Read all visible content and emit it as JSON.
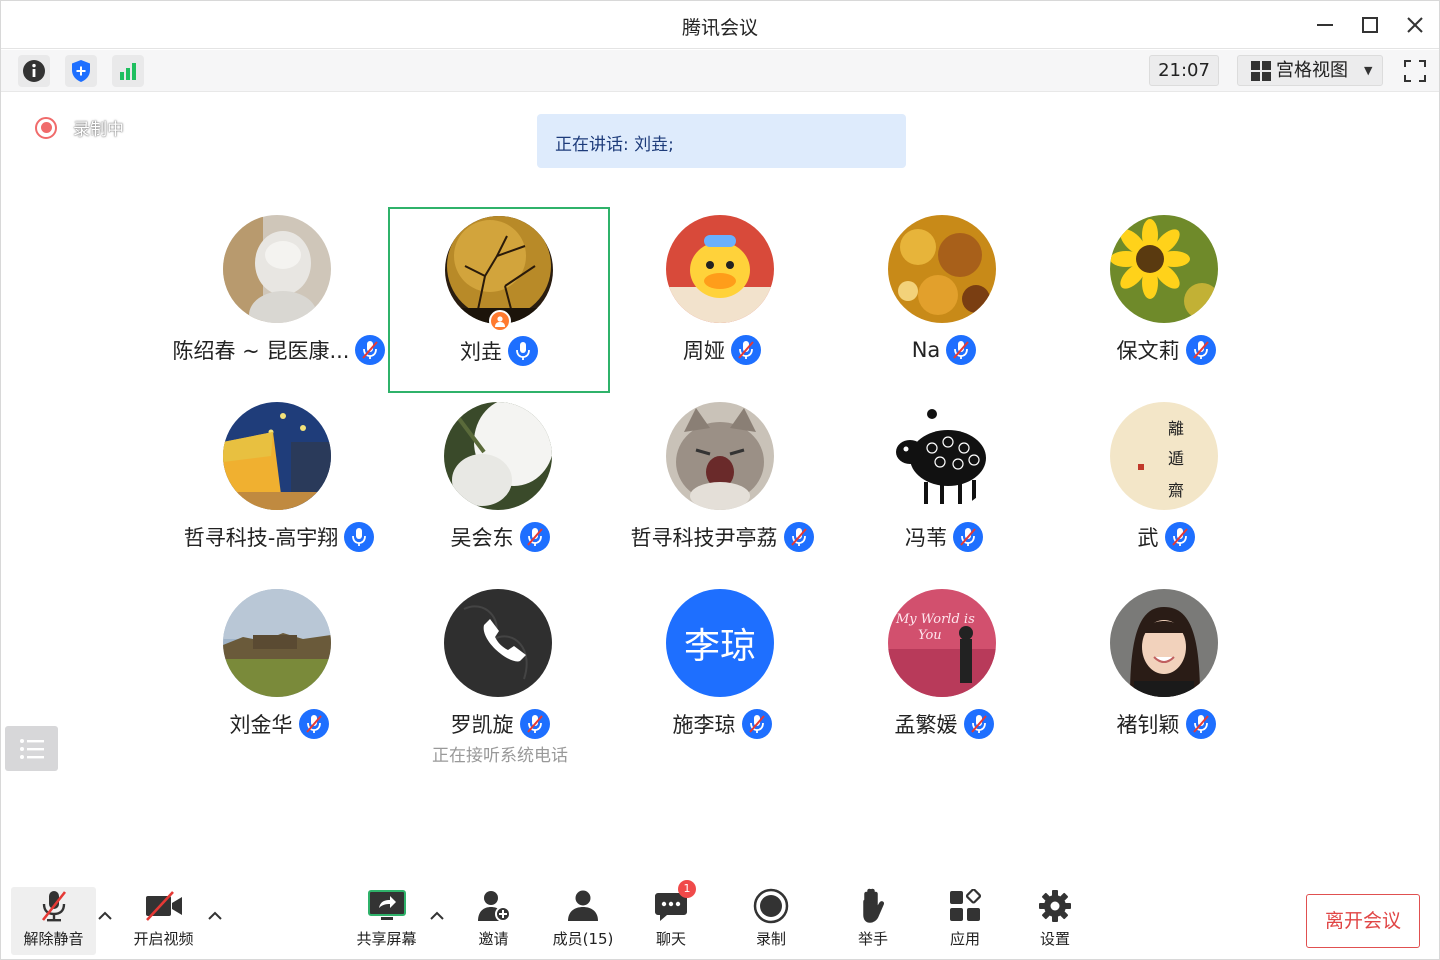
{
  "window": {
    "title": "腾讯会议"
  },
  "toolbar": {
    "clock": "21:07",
    "view_label": "宫格视图"
  },
  "recording": {
    "label": "录制中"
  },
  "speaking": {
    "text": "正在讲话: 刘垚;"
  },
  "participants": [
    {
      "name": "陈绍春 ~ 昆医康...",
      "mic": "muted",
      "avatar": "figurine-photo"
    },
    {
      "name": "刘垚",
      "mic": "active",
      "avatar": "moon-photo",
      "host": true
    },
    {
      "name": "周娅",
      "mic": "muted",
      "avatar": "duck-photo"
    },
    {
      "name": "Na",
      "mic": "muted",
      "avatar": "food-photo"
    },
    {
      "name": "保文莉",
      "mic": "muted",
      "avatar": "sunflower-photo"
    },
    {
      "name": "哲寻科技-高宇翔",
      "mic": "active",
      "avatar": "cafe-painting"
    },
    {
      "name": "吴会东",
      "mic": "muted",
      "avatar": "flower-photo"
    },
    {
      "name": "哲寻科技尹亭荔",
      "mic": "muted",
      "avatar": "cat-photo"
    },
    {
      "name": "冯苇",
      "mic": "muted",
      "avatar": "sheep-drawing"
    },
    {
      "name": "武",
      "mic": "muted",
      "avatar": "calligraphy"
    },
    {
      "name": "刘金华",
      "mic": "muted",
      "avatar": "landscape-photo"
    },
    {
      "name": "罗凯旋",
      "mic": "muted",
      "avatar": "phone-call",
      "status": "正在接听系统电话"
    },
    {
      "name": "施李琼",
      "mic": "muted",
      "avatar": "text-avatar",
      "avatar_text": "李琼"
    },
    {
      "name": "孟繁媛",
      "mic": "muted",
      "avatar": "neon-photo"
    },
    {
      "name": "褚钊颖",
      "mic": "muted",
      "avatar": "portrait-photo"
    }
  ],
  "bottom": {
    "unmute": "解除静音",
    "video": "开启视频",
    "share": "共享屏幕",
    "invite": "邀请",
    "members": "成员(15)",
    "chat": "聊天",
    "chat_badge": "1",
    "record": "录制",
    "raise_hand": "举手",
    "apps": "应用",
    "settings": "设置",
    "leave": "离开会议"
  },
  "colors": {
    "accent": "#1e6fff",
    "active_border": "#2fb26a",
    "leave": "#e04545",
    "speaking_bg": "#deebfc"
  }
}
